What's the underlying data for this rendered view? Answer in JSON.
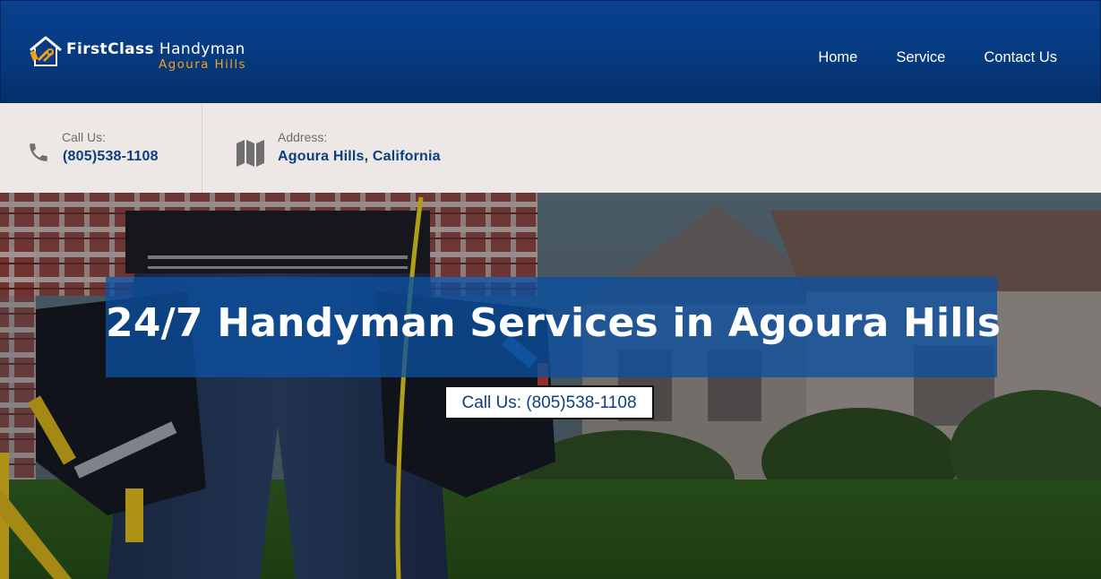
{
  "header": {
    "logo": {
      "line1_bold": "FirstClass",
      "line1_rest": " Handyman",
      "line2": "Agoura Hills",
      "icon": "house-tools-logo-icon"
    },
    "nav": [
      {
        "label": "Home"
      },
      {
        "label": "Service"
      },
      {
        "label": "Contact Us"
      }
    ],
    "colors": {
      "background": "#063a80",
      "logo_accent": "#f5a01a"
    }
  },
  "infobar": {
    "call": {
      "label": "Call Us:",
      "value": "(805)538-1108",
      "icon": "phone-icon"
    },
    "address": {
      "label": "Address:",
      "value": "Agoura Hills, California",
      "icon": "map-icon"
    },
    "colors": {
      "background": "#ede7e6",
      "value": "#0b3f7f"
    }
  },
  "hero": {
    "title": "24/7 Handyman Services in Agoura Hills",
    "call_button": "Call Us: (805)538-1108",
    "background": "handyman-tool-belt-photo",
    "colors": {
      "title_box": "#0c50a0"
    }
  }
}
